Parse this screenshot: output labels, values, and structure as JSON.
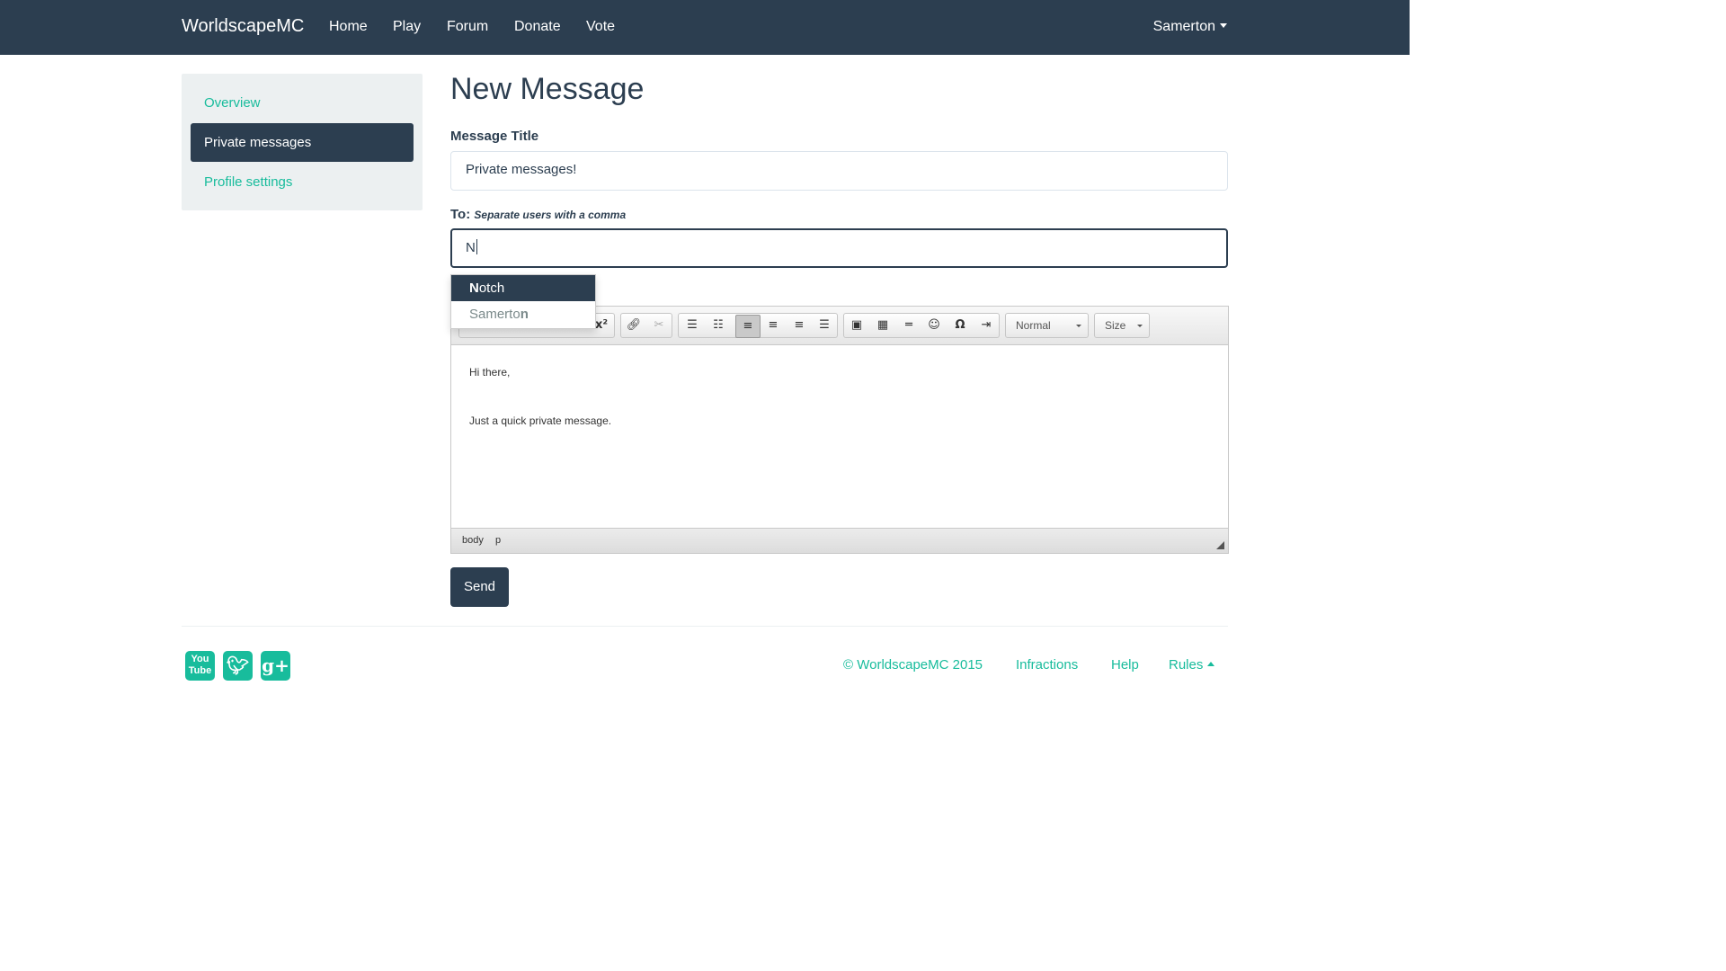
{
  "navbar": {
    "brand": "WorldscapeMC",
    "links": [
      "Home",
      "Play",
      "Forum",
      "Donate",
      "Vote"
    ],
    "user": "Samerton"
  },
  "sidebar": {
    "items": [
      {
        "label": "Overview",
        "active": false
      },
      {
        "label": "Private messages",
        "active": true
      },
      {
        "label": "Profile settings",
        "active": false
      }
    ]
  },
  "main": {
    "title": "New Message",
    "message_title_label": "Message Title",
    "message_title_value": "Private messages!",
    "to_label": "To:",
    "to_hint": "Separate users with a comma",
    "to_value": "N",
    "autocomplete": [
      {
        "match": "N",
        "rest": "otch",
        "full": "Notch"
      },
      {
        "prefix": "Samerto",
        "match": "n",
        "full": "Samerton"
      }
    ],
    "editor": {
      "toolbar": {
        "format_label": "Normal",
        "size_label": "Size",
        "superscript": "x²"
      },
      "content": [
        "Hi there,",
        "Just a quick private message."
      ],
      "path": [
        "body",
        "p"
      ]
    },
    "send_label": "Send"
  },
  "footer": {
    "social": [
      "youtube-icon",
      "twitter-icon",
      "google-plus-icon"
    ],
    "copyright": "© WorldscapeMC 2015",
    "links": [
      "Infractions",
      "Help",
      "Rules"
    ]
  },
  "colors": {
    "primary": "#2c3e50",
    "accent": "#18bc9c",
    "light": "#ecf0f1"
  }
}
